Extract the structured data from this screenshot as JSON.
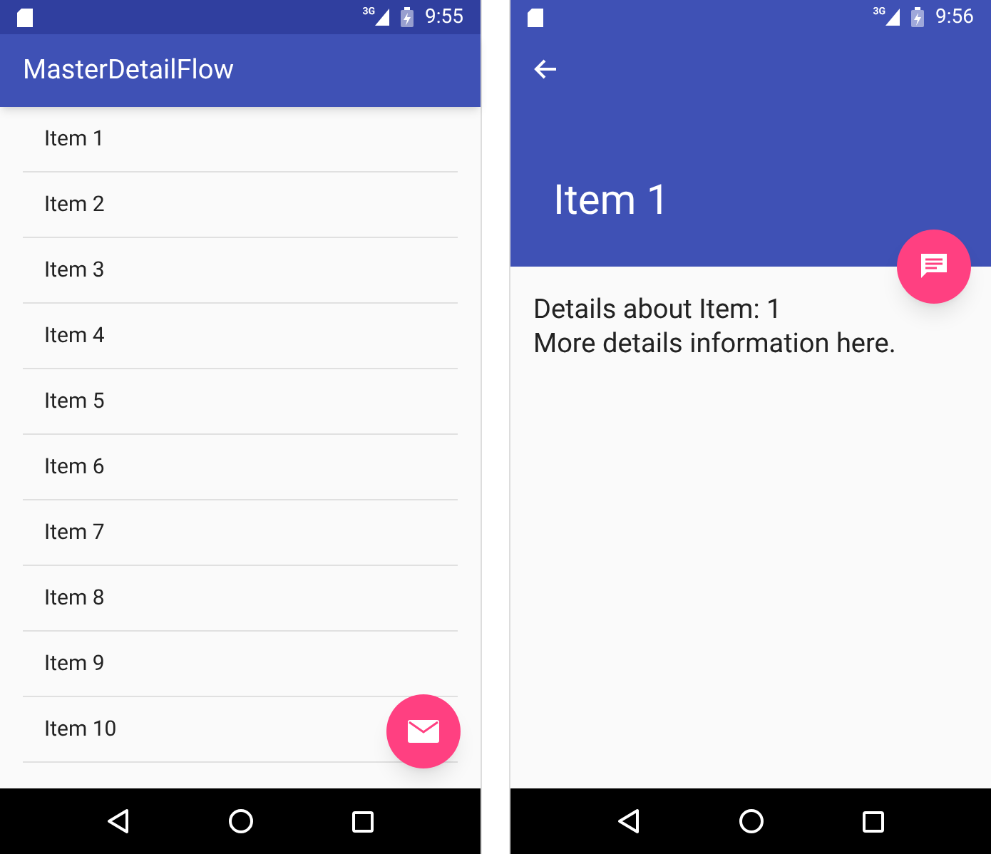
{
  "master_screen": {
    "status_bar": {
      "time": "9:55",
      "network": "3G"
    },
    "toolbar": {
      "title": "MasterDetailFlow"
    },
    "items": [
      {
        "label": "Item 1"
      },
      {
        "label": "Item 2"
      },
      {
        "label": "Item 3"
      },
      {
        "label": "Item 4"
      },
      {
        "label": "Item 5"
      },
      {
        "label": "Item 6"
      },
      {
        "label": "Item 7"
      },
      {
        "label": "Item 8"
      },
      {
        "label": "Item 9"
      },
      {
        "label": "Item 10"
      }
    ]
  },
  "detail_screen": {
    "status_bar": {
      "time": "9:56",
      "network": "3G"
    },
    "title": "Item 1",
    "details": [
      "Details about Item: 1",
      "More details information here."
    ]
  }
}
